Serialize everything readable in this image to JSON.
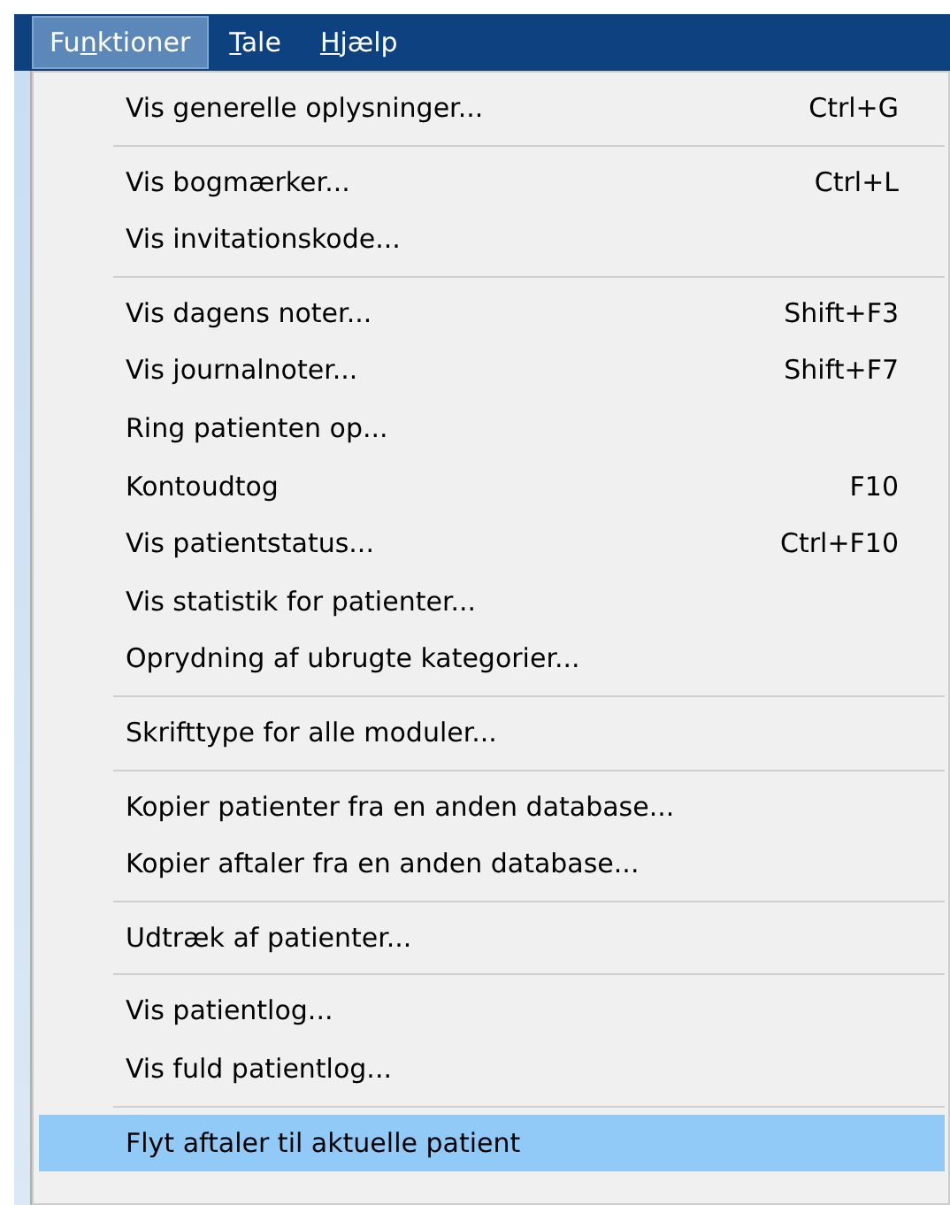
{
  "menu_bar": [
    {
      "before": "Fu",
      "access_key": "n",
      "after": "ktioner",
      "selected": true
    },
    {
      "access_key": "T",
      "after": "ale",
      "selected": false
    },
    {
      "access_key": "H",
      "after": "jælp",
      "selected": false
    }
  ],
  "menu": [
    {
      "kind": "item",
      "label": "Vis generelle oplysninger...",
      "shortcut": "Ctrl+G",
      "selected": false
    },
    {
      "kind": "separator"
    },
    {
      "kind": "item",
      "label": "Vis bogmærker...",
      "shortcut": "Ctrl+L",
      "selected": false
    },
    {
      "kind": "item",
      "label": "Vis invitationskode...",
      "selected": false
    },
    {
      "kind": "separator"
    },
    {
      "kind": "item",
      "label": "Vis dagens noter...",
      "shortcut": "Shift+F3",
      "selected": false
    },
    {
      "kind": "item",
      "label": "Vis journalnoter...",
      "shortcut": "Shift+F7",
      "selected": false
    },
    {
      "kind": "item",
      "label": "Ring patienten op...",
      "selected": false
    },
    {
      "kind": "item",
      "label": "Kontoudtog",
      "shortcut": "F10",
      "selected": false
    },
    {
      "kind": "item",
      "label": "Vis patientstatus...",
      "shortcut": "Ctrl+F10",
      "selected": false
    },
    {
      "kind": "item",
      "label": "Vis statistik for patienter...",
      "selected": false
    },
    {
      "kind": "item",
      "label": "Oprydning af ubrugte kategorier...",
      "selected": false
    },
    {
      "kind": "separator"
    },
    {
      "kind": "item",
      "label": "Skrifttype for alle moduler...",
      "selected": false
    },
    {
      "kind": "separator"
    },
    {
      "kind": "item",
      "label": "Kopier patienter fra en anden database...",
      "selected": false
    },
    {
      "kind": "item",
      "label": "Kopier aftaler fra en anden database...",
      "selected": false
    },
    {
      "kind": "separator"
    },
    {
      "kind": "item",
      "label": "Udtræk af patienter...",
      "selected": false
    },
    {
      "kind": "separator"
    },
    {
      "kind": "item",
      "label": "Vis patientlog...",
      "selected": false
    },
    {
      "kind": "item",
      "label": "Vis fuld patientlog...",
      "selected": false
    },
    {
      "kind": "separator"
    },
    {
      "kind": "item",
      "label": "Flyt aftaler til aktuelle patient",
      "selected": true
    }
  ]
}
